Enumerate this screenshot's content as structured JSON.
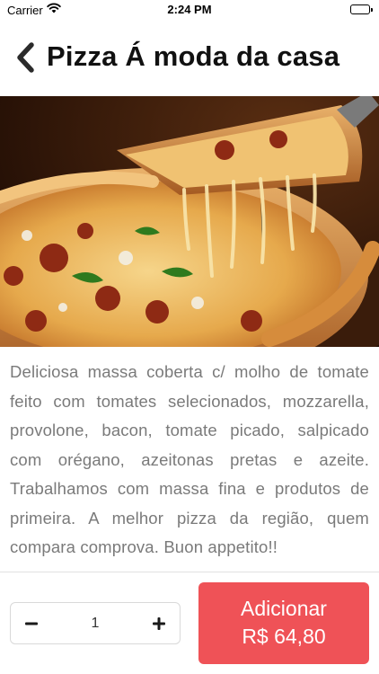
{
  "status_bar": {
    "carrier": "Carrier",
    "time": "2:24 PM",
    "wifi_icon": "wifi-icon",
    "battery_icon": "battery-icon"
  },
  "header": {
    "title": "Pizza Á moda da casa",
    "back_icon": "chevron-left-icon"
  },
  "product": {
    "image_subject": "pizza slice with melted cheese",
    "description": "Deliciosa massa coberta c/ molho de tomate feito com tomates selecionados, mozzarella, provolone, bacon, tomate picado, salpicado com orégano, azeitonas pretas e azeite. Trabalhamos com massa fina e produtos de primeira. A melhor pizza da região, quem compara comprova. Buon appetito!!"
  },
  "order": {
    "quantity": "1",
    "minus_icon": "minus-icon",
    "plus_icon": "plus-icon",
    "add_label": "Adicionar",
    "price": "R$ 64,80"
  },
  "colors": {
    "accent": "#ef5257",
    "description_text": "#7a7a7a",
    "title_text": "#111111"
  }
}
